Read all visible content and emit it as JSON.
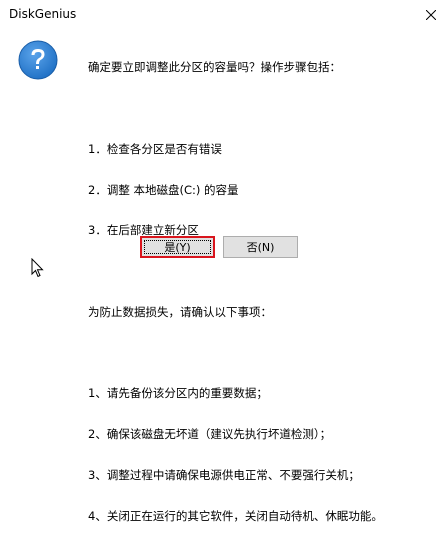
{
  "window": {
    "title": "DiskGenius"
  },
  "message": {
    "lines": [
      "确定要立即调整此分区的容量吗？操作步骤包括：",
      "",
      "1．检查各分区是否有错误",
      "2．调整 本地磁盘(C:) 的容量",
      "3．在后部建立新分区",
      "",
      "为防止数据损失，请确认以下事项：",
      "",
      "1、请先备份该分区内的重要数据；",
      "2、确保该磁盘无坏道（建议先执行坏道检测）；",
      "3、调整过程中请确保电源供电正常、不要强行关机；",
      "4、关闭正在运行的其它软件，关闭自动待机、休眠功能。"
    ]
  },
  "buttons": {
    "yes_label": "是(Y)",
    "no_label": "否(N)"
  },
  "icons": {
    "dialog_icon": "question-icon",
    "close": "close-icon"
  },
  "colors": {
    "question_icon": "#1e6fc4",
    "focus_outline": "#d9151d"
  }
}
